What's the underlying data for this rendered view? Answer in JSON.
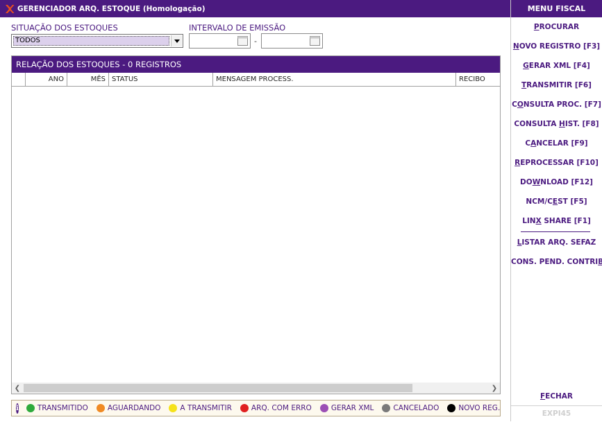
{
  "window": {
    "title": "GERENCIADOR ARQ. ESTOQUE (Homologação)"
  },
  "filters": {
    "situacao_label": "SITUAÇÃO DOS ESTOQUES",
    "situacao_value": "TODOS",
    "intervalo_label": "INTERVALO DE EMISSÃO",
    "date_from": "",
    "date_to": "",
    "separator": "-"
  },
  "grid": {
    "title": "RELAÇÃO DOS ESTOQUES - 0 REGISTROS",
    "columns": [
      "",
      "ANO",
      "MÊS",
      "STATUS",
      "MENSAGEM PROCESS.",
      "RECIBO"
    ],
    "rows": []
  },
  "legend": {
    "info_glyph": "i",
    "items": [
      {
        "label": "TRANSMITIDO",
        "color": "#2eaa3c"
      },
      {
        "label": "AGUARDANDO",
        "color": "#f08a24"
      },
      {
        "label": "A TRANSMITIR",
        "color": "#f5e21a"
      },
      {
        "label": "ARQ. COM ERRO",
        "color": "#e02020"
      },
      {
        "label": "GERAR XML",
        "color": "#9b4fb5"
      },
      {
        "label": "CANCELADO",
        "color": "#7a7a7a"
      },
      {
        "label": "NOVO REG.",
        "color": "#000000"
      }
    ]
  },
  "menu": {
    "title": "MENU FISCAL",
    "items": [
      {
        "pre": "",
        "u": "P",
        "post": "ROCURAR"
      },
      {
        "pre": "",
        "u": "N",
        "post": "OVO REGISTRO [F3]"
      },
      {
        "pre": "",
        "u": "G",
        "post": "ERAR XML [F4]"
      },
      {
        "pre": "",
        "u": "T",
        "post": "RANSMITIR [F6]"
      },
      {
        "pre": "C",
        "u": "O",
        "post": "NSULTA PROC. [F7]"
      },
      {
        "pre": "CONSULTA ",
        "u": "H",
        "post": "IST. [F8]"
      },
      {
        "pre": "C",
        "u": "A",
        "post": "NCELAR [F9]"
      },
      {
        "pre": "",
        "u": "R",
        "post": "EPROCESSAR [F10]"
      },
      {
        "pre": "DO",
        "u": "W",
        "post": "NLOAD [F12]"
      },
      {
        "pre": "NCM/C",
        "u": "E",
        "post": "ST [F5]"
      },
      {
        "pre": "LIN",
        "u": "X",
        "post": " SHARE [F1]"
      },
      {
        "pre": "",
        "u": "L",
        "post": "ISTAR ARQ. SEFAZ"
      },
      {
        "pre": "CONS. PEND. CONTRI",
        "u": "B",
        "post": "."
      }
    ],
    "fechar": {
      "pre": "",
      "u": "F",
      "post": "ECHAR"
    },
    "footer": "EXPI45"
  },
  "colors": {
    "brand": "#4b1a80",
    "logo": "#e8501e"
  },
  "icons": {
    "logo": "app-logo-icon",
    "dropdown": "chevron-down-icon",
    "calendar": "calendar-icon",
    "info": "info-icon",
    "scroll_left": "chevron-left-icon",
    "scroll_right": "chevron-right-icon"
  }
}
